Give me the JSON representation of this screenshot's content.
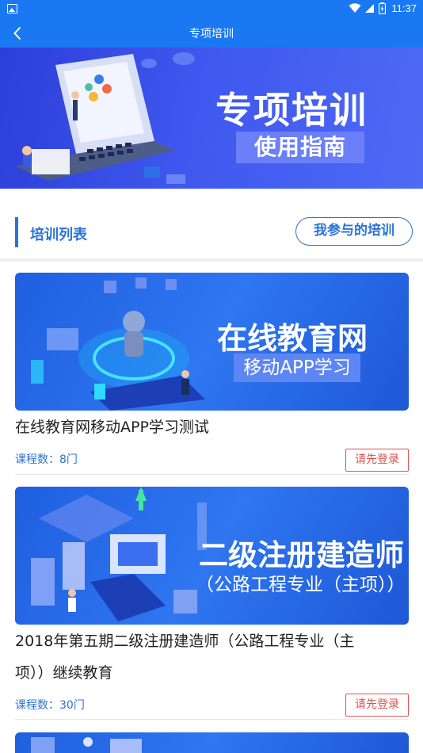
{
  "status_bar": {
    "time": "11:37"
  },
  "header": {
    "title": "专项培训"
  },
  "banner": {
    "title": "专项培训",
    "subtitle": "使用指南"
  },
  "section": {
    "title": "培训列表",
    "my_training_label": "我参与的培训"
  },
  "courses": [
    {
      "image_title": "在线教育网",
      "image_subtitle": "移动APP学习",
      "name": "在线教育网移动APP学习测试",
      "count_text": "课程数：8门",
      "login_label": "请先登录"
    },
    {
      "image_title": "二级注册建造师",
      "image_subtitle": "（公路工程专业（主项））",
      "name_line1": "2018年第五期二级注册建造师（公路工程专业（主",
      "name_line2": "项））继续教育",
      "count_text": "课程数：30门",
      "login_label": "请先登录"
    }
  ],
  "colors": {
    "primary": "#1a78f2",
    "accent_blue": "#2b73d9",
    "login_red": "#e05050"
  }
}
